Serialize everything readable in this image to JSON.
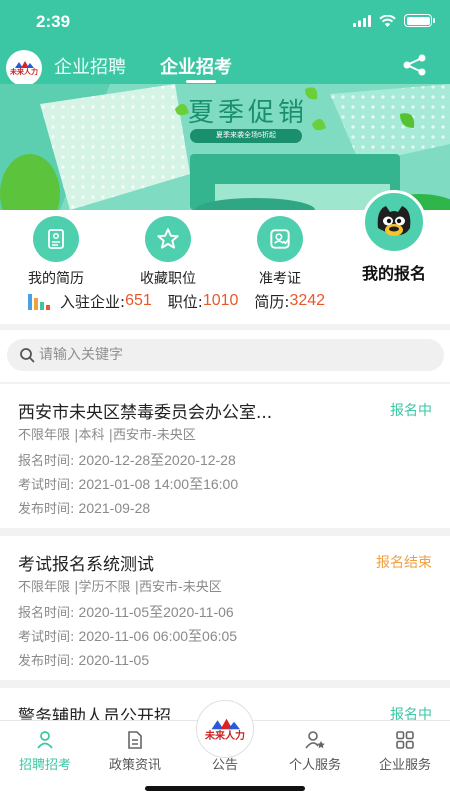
{
  "status_bar": {
    "time": "2:39"
  },
  "header": {
    "logo_text": "未来人力",
    "tabs": [
      {
        "label": "企业招聘",
        "active": false
      },
      {
        "label": "企业招考",
        "active": true
      }
    ],
    "share_icon": "share-icon",
    "accent_color": "#3cc7a4"
  },
  "banner": {
    "title": "夏季促销",
    "subtitle": "夏季来袭全场5折起"
  },
  "quick_menu": [
    {
      "label": "我的简历",
      "icon": "resume-icon"
    },
    {
      "label": "收藏职位",
      "icon": "star-icon"
    },
    {
      "label": "准考证",
      "icon": "admission-ticket-icon"
    },
    {
      "label": "我的报名",
      "icon": "cat-avatar-icon"
    }
  ],
  "stats": {
    "enterprises_label": "入驻企业:",
    "enterprises": "651",
    "positions_label": "职位:",
    "positions": "1010",
    "resumes_label": "简历:",
    "resumes": "3242"
  },
  "search": {
    "placeholder": "请输入关键字"
  },
  "jobs": [
    {
      "title": "西安市未央区禁毒委员会办公室...",
      "status": "报名中",
      "status_color": "#3cc7a4",
      "tags": "不限年限 |本科 |西安市-未央区",
      "signup_label": "报名时间:",
      "signup": "2020-12-28至2020-12-28",
      "exam_label": "考试时间:",
      "exam": "2021-01-08 14:00至16:00",
      "publish_label": "发布时间:",
      "publish": "2021-09-28"
    },
    {
      "title": "考试报名系统测试",
      "status": "报名结束",
      "status_color": "#f0a040",
      "tags": "不限年限 |学历不限 |西安市-未央区",
      "signup_label": "报名时间:",
      "signup": "2020-11-05至2020-11-06",
      "exam_label": "考试时间:",
      "exam": "2020-11-06 06:00至06:05",
      "publish_label": "发布时间:",
      "publish": "2020-11-05"
    },
    {
      "title": "警务辅助人员公开招",
      "status": "报名中",
      "status_color": "#3cc7a4"
    }
  ],
  "tabbar": [
    {
      "label": "招聘招考",
      "icon": "person-icon",
      "active": true
    },
    {
      "label": "政策资讯",
      "icon": "document-icon",
      "active": false
    },
    {
      "label": "公告",
      "icon": "center-logo-icon",
      "active": false
    },
    {
      "label": "个人服务",
      "icon": "personal-service-icon",
      "active": false
    },
    {
      "label": "企业服务",
      "icon": "grid-icon",
      "active": false
    }
  ],
  "center_logo_text": "未来人力"
}
